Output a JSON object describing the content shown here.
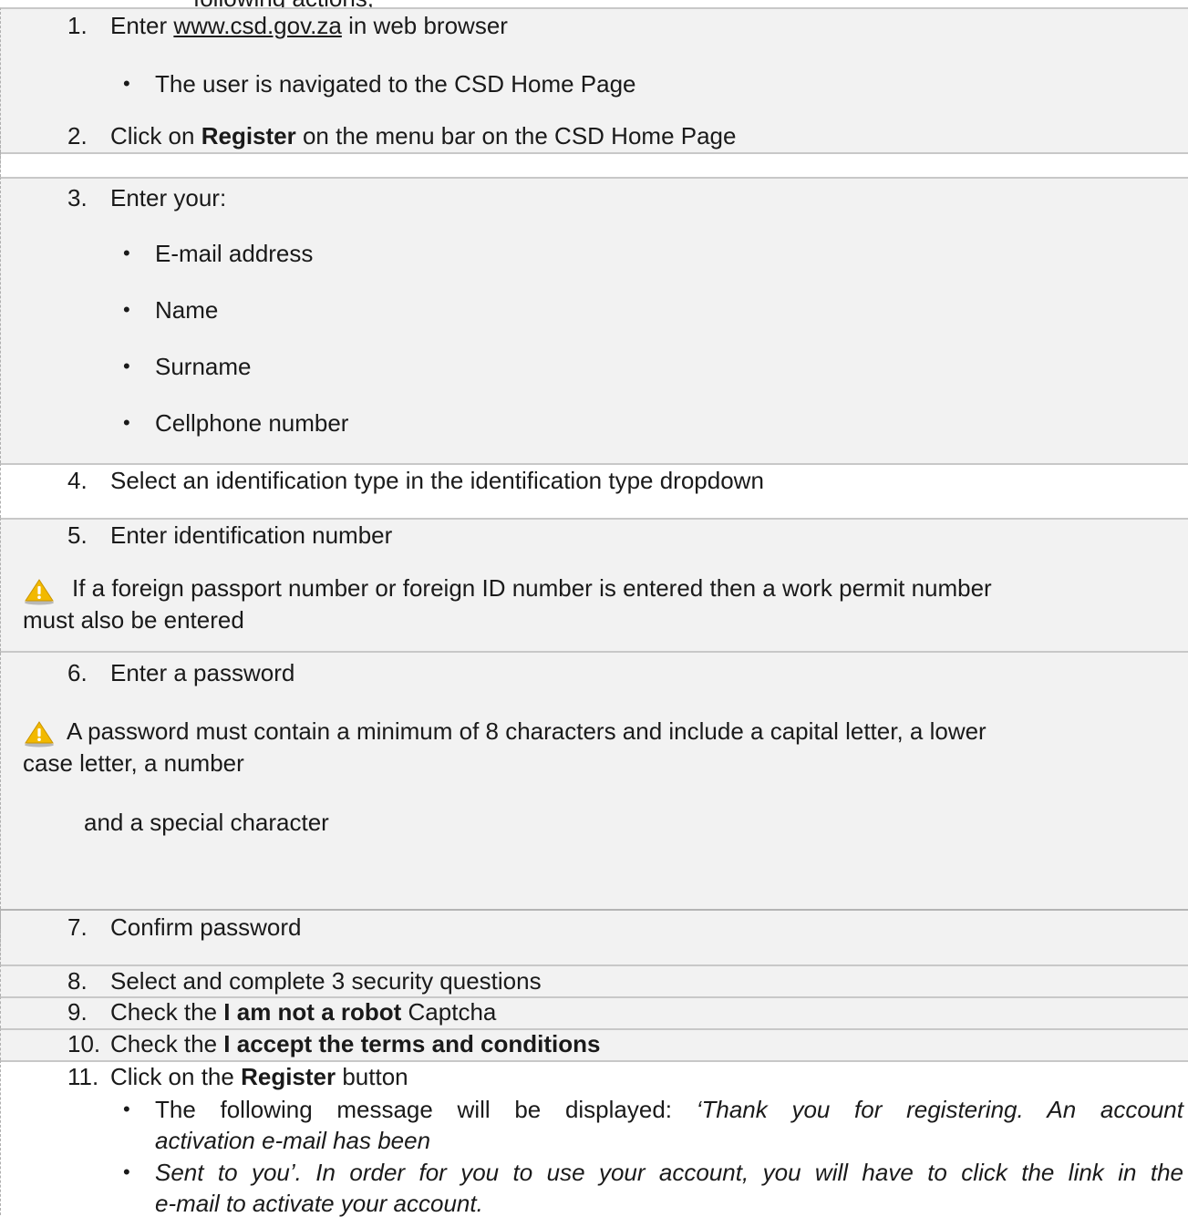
{
  "intro_cutoff": "following actions;",
  "steps": {
    "s1": {
      "num": "1.",
      "pre": "Enter ",
      "link": "www.csd.gov.za",
      "post": " in web browser",
      "bullet": "The user is navigated to the CSD Home Page"
    },
    "s2": {
      "num": "2.",
      "pre": "Click on ",
      "bold": "Register",
      "post": " on the menu bar on the CSD Home Page"
    },
    "s3": {
      "num": "3.",
      "text": "Enter your:",
      "bullets": [
        "E-mail address",
        "Name",
        "Surname",
        "Cellphone number"
      ]
    },
    "s4": {
      "num": "4.",
      "text": "Select an identification type in the identification type dropdown"
    },
    "s5": {
      "num": "5.",
      "text": "Enter identification number",
      "warn_line1": "If a foreign passport number or foreign ID number is entered then a work permit number",
      "warn_line2": "must also be entered"
    },
    "s6": {
      "num": "6.",
      "text": "Enter a password",
      "warn_line1": "A password must contain a minimum of 8 characters and include a capital letter, a lower",
      "warn_line2": "case letter, a number",
      "warn_line3": "and a special character"
    },
    "s7": {
      "num": "7.",
      "text": "Confirm password"
    },
    "s8": {
      "num": "8.",
      "text": "Select and complete 3 security questions"
    },
    "s9": {
      "num": "9.",
      "pre": "Check the ",
      "bold": "I am not a robot",
      "post": " Captcha"
    },
    "s10": {
      "num": "10.",
      "pre": "Check the ",
      "bold": "I accept the terms and conditions"
    },
    "s11": {
      "num": "11.",
      "pre": "Click on the ",
      "bold": "Register",
      "post": " button",
      "b1_pre": "The following message will be displayed: ",
      "b1_italic": "‘Thank you for registering. An account",
      "b1_line2": "activation e-mail has been",
      "b2_italic": " Sent to you’.  In order for you to use your account, you will have to click the link in the",
      "b2_line2": "e-mail to activate your account."
    }
  },
  "icons": {
    "warning": "warning-icon"
  }
}
